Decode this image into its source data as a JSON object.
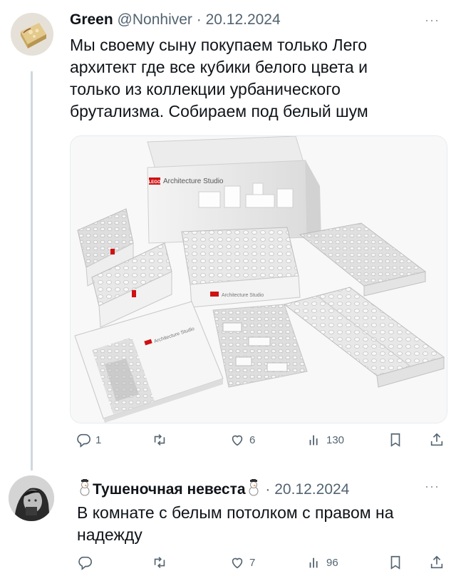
{
  "tweet": {
    "author_name": "Green",
    "handle_date": "@Nonhiver · 20.12.2024",
    "more": "···",
    "text_lines": [
      "Мы своему сыну покупаем только Лего",
      "архитект где все кубики белого цвета и",
      "только из коллекции урбанического",
      "брутализма. Собираем под белый шум"
    ],
    "media": {
      "box_brand": "LEGO",
      "box_title": "Architecture Studio"
    },
    "stats": {
      "replies": "1",
      "likes": "6",
      "views": "130"
    }
  },
  "reply": {
    "author_name": "Тушеночная невеста",
    "date": "· 20.12.2024",
    "more": "···",
    "text_lines": [
      "В комнате с белым потолком с правом на",
      "надежду"
    ],
    "stats": {
      "likes": "7",
      "views": "96"
    }
  },
  "colors": {
    "text": "#0f1419",
    "muted": "#536471",
    "thread": "#cfd9de",
    "lego_red": "#d01012"
  },
  "icons": [
    "reply-icon",
    "retweet-icon",
    "like-icon",
    "views-icon",
    "bookmark-icon",
    "share-icon",
    "snowman-icon"
  ]
}
